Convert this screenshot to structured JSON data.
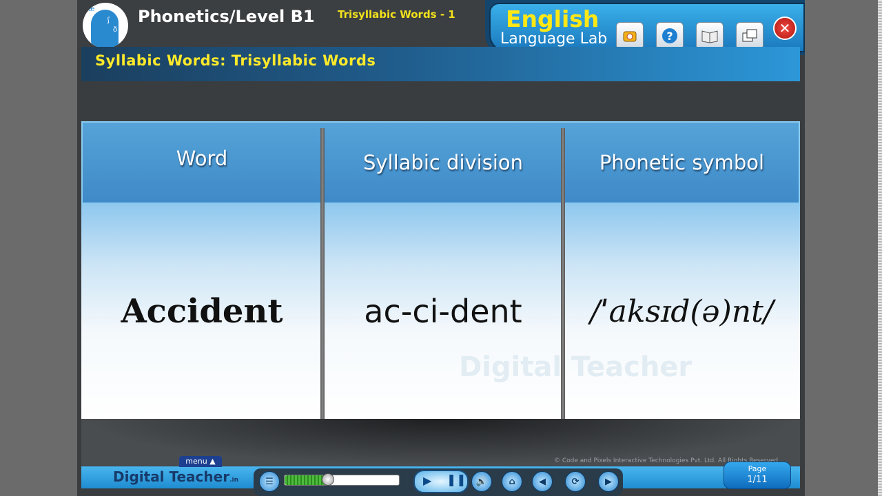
{
  "header": {
    "app_title": "Phonetics/Level B1",
    "lesson_title": "Trisyllabic Words - 1",
    "brand_line1": "English",
    "brand_line2": "Language Lab"
  },
  "toolbar": {
    "icons": [
      "clock-icon",
      "help-icon",
      "book-icon",
      "window-icon",
      "close-icon"
    ]
  },
  "section": {
    "title": "Syllabic Words: Trisyllabic Words"
  },
  "table": {
    "headers": [
      "Word",
      "Syllabic division",
      "Phonetic symbol"
    ],
    "row": {
      "word": "Accident",
      "syllabic_division": "ac-ci-dent",
      "phonetic_symbol": "/ˈaksɪd(ə)nt/"
    }
  },
  "watermark": "Digital Teacher",
  "footer": {
    "logo": "Digital Teacher",
    "logo_suffix": ".in",
    "menu_label": "menu",
    "copyright": "© Code and Pixels Interactive Technologies Pvt. Ltd. All Rights Reserved",
    "page_label": "Page",
    "page_value": "1/11",
    "audio_progress_percent": 38
  }
}
